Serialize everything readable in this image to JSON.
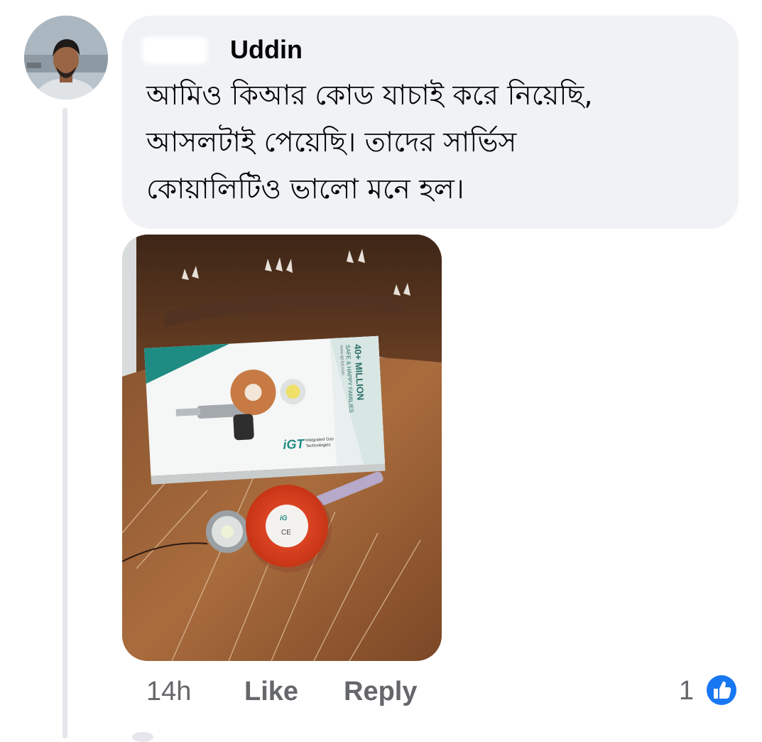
{
  "comment": {
    "author": {
      "name_visible": "Uddin",
      "avatar": "profile-photo"
    },
    "text_lines": [
      "আমিও কিআর কোড যাচাই করে নিয়েছি,",
      "আসলটাই পেয়েছি। তাদের সার্ভিস",
      "কোয়ালিটিও ভালো মনে হল।"
    ],
    "photo": {
      "box_headline": "40+ MILLION",
      "box_tagline": "SAFE & HAPPY FAMILIES",
      "box_url": "www.igt-bd.com",
      "brand_mark": "iGT",
      "brand_name_line1": "Integrated Gas",
      "brand_name_line2": "Technologies",
      "regulator_mark": "CE"
    },
    "timestamp": "14h",
    "like_label": "Like",
    "reply_label": "Reply",
    "reaction_count": "1"
  },
  "colors": {
    "bubble_bg": "#f0f2f5",
    "meta_text": "#65676b",
    "like_blue": "#1877f2"
  }
}
